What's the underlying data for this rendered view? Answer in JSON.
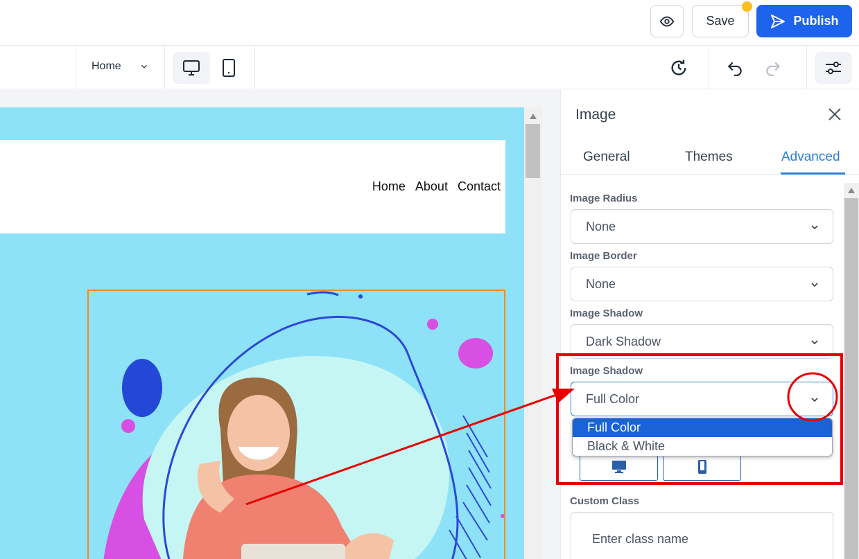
{
  "topbar": {
    "save_label": "Save",
    "publish_label": "Publish",
    "accent": "#1d63ed"
  },
  "toolbar": {
    "page_select": "Home",
    "icons": [
      "chevron-down-icon",
      "desktop-icon",
      "mobile-icon",
      "history-icon",
      "undo-icon",
      "redo-icon",
      "sliders-icon"
    ]
  },
  "site": {
    "nav": [
      "Home",
      "About",
      "Contact"
    ],
    "background": "#8ee2f7"
  },
  "panel": {
    "title": "Image",
    "tabs": [
      {
        "label": "General",
        "active": false
      },
      {
        "label": "Themes",
        "active": false
      },
      {
        "label": "Advanced",
        "active": true
      }
    ],
    "fields": [
      {
        "label": "Image Radius",
        "value": "None"
      },
      {
        "label": "Image Border",
        "value": "None"
      },
      {
        "label": "Image Shadow",
        "value": "Dark Shadow"
      },
      {
        "label": "Image Shadow",
        "value": "Full Color"
      }
    ],
    "dropdown_options": [
      {
        "label": "Full Color",
        "selected": true
      },
      {
        "label": "Black & White",
        "selected": false
      }
    ],
    "custom_class_label": "Custom Class",
    "custom_class_placeholder": "Enter class name"
  },
  "annotation_color": "#e80000"
}
